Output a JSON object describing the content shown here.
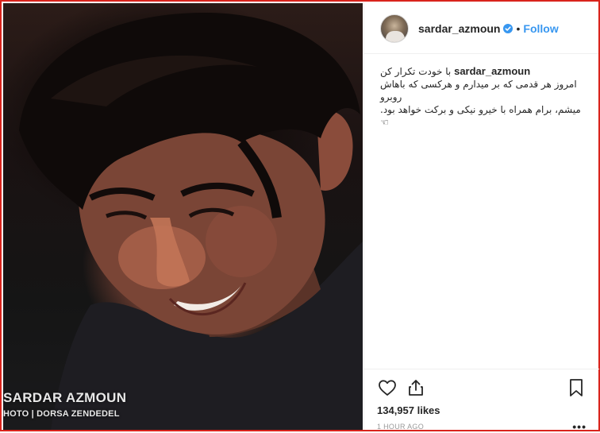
{
  "post": {
    "watermark_line1": "SARDAR AZMOUN",
    "watermark_line2": "HOTO | DORSA ZENDEDEL"
  },
  "header": {
    "username": "sardar_azmoun",
    "separator": "•",
    "follow_label": "Follow",
    "verified_icon": "verified-badge-icon",
    "accent_color": "#3897f0"
  },
  "caption": {
    "username": "sardar_azmoun",
    "line1": "با خودت تکرار کن",
    "line2": "امروز هر قدمی که بر میدارم و هرکسی که باهاش روبرو",
    "line3": "میشم، برام همراه با خیرو نیکی و برکت خواهد بود.☜"
  },
  "actions": {
    "like_icon": "heart-outline-icon",
    "share_icon": "share-icon",
    "save_icon": "bookmark-icon",
    "likes_text": "134,957 likes",
    "timestamp": "1 HOUR AGO",
    "more_label": "•••"
  },
  "colors": {
    "frame_border": "#d9241c",
    "text_primary": "#262626",
    "text_secondary": "#999999"
  }
}
